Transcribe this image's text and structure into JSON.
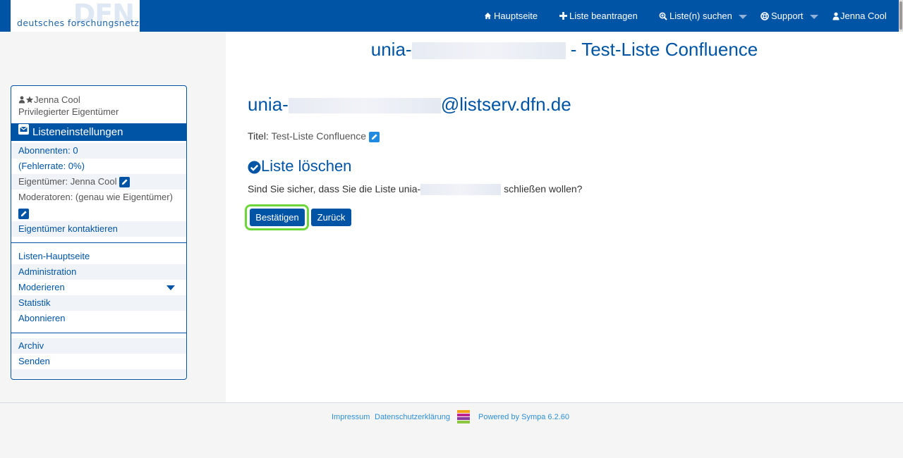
{
  "brand": {
    "logo_big": "DFN",
    "logo_text": "deutsches forschungsnetz"
  },
  "nav": {
    "home": "Hauptseite",
    "request_list": "Liste beantragen",
    "search_lists": "Liste(n) suchen",
    "support": "Support",
    "user": "Jenna Cool"
  },
  "sidebar": {
    "user_name": "Jenna Cool",
    "user_role": "Privilegierter Eigentümer",
    "section_title": "Listeneinstellungen",
    "subscribers": "Abonnenten: 0",
    "error_rate": "(Fehlerrate: 0%)",
    "owners": "Eigentümer: Jenna Cool",
    "moderators": "Moderatoren: (genau wie Eigentümer)",
    "contact_owners": "Eigentümer kontaktieren",
    "menu": {
      "list_home": "Listen-Hauptseite",
      "administration": "Administration",
      "moderate": "Moderieren",
      "statistics": "Statistik",
      "subscribe": "Abonnieren"
    },
    "archive": "Archiv",
    "send": "Senden"
  },
  "main": {
    "page_title_prefix": "unia-",
    "page_title_suffix": " - Test-Liste Confluence",
    "address_prefix": "unia-",
    "address_suffix": "@listserv.dfn.de",
    "title_label": "Titel:",
    "title_value": "Test-Liste Confluence",
    "heading": "Liste löschen",
    "question_prefix": "Sind Sie sicher, dass Sie die Liste unia-",
    "question_suffix": "schließen wollen?",
    "confirm_button": "Bestätigen",
    "back_button": "Zurück"
  },
  "footer": {
    "impressum": "Impressum",
    "privacy": "Datenschutzerklärung",
    "powered_by": "Powered by Sympa 6.2.60"
  },
  "colors": {
    "brand_blue": "#0054a6",
    "focus_ring": "#6cd63b",
    "footer_link": "#2e8fd8"
  }
}
